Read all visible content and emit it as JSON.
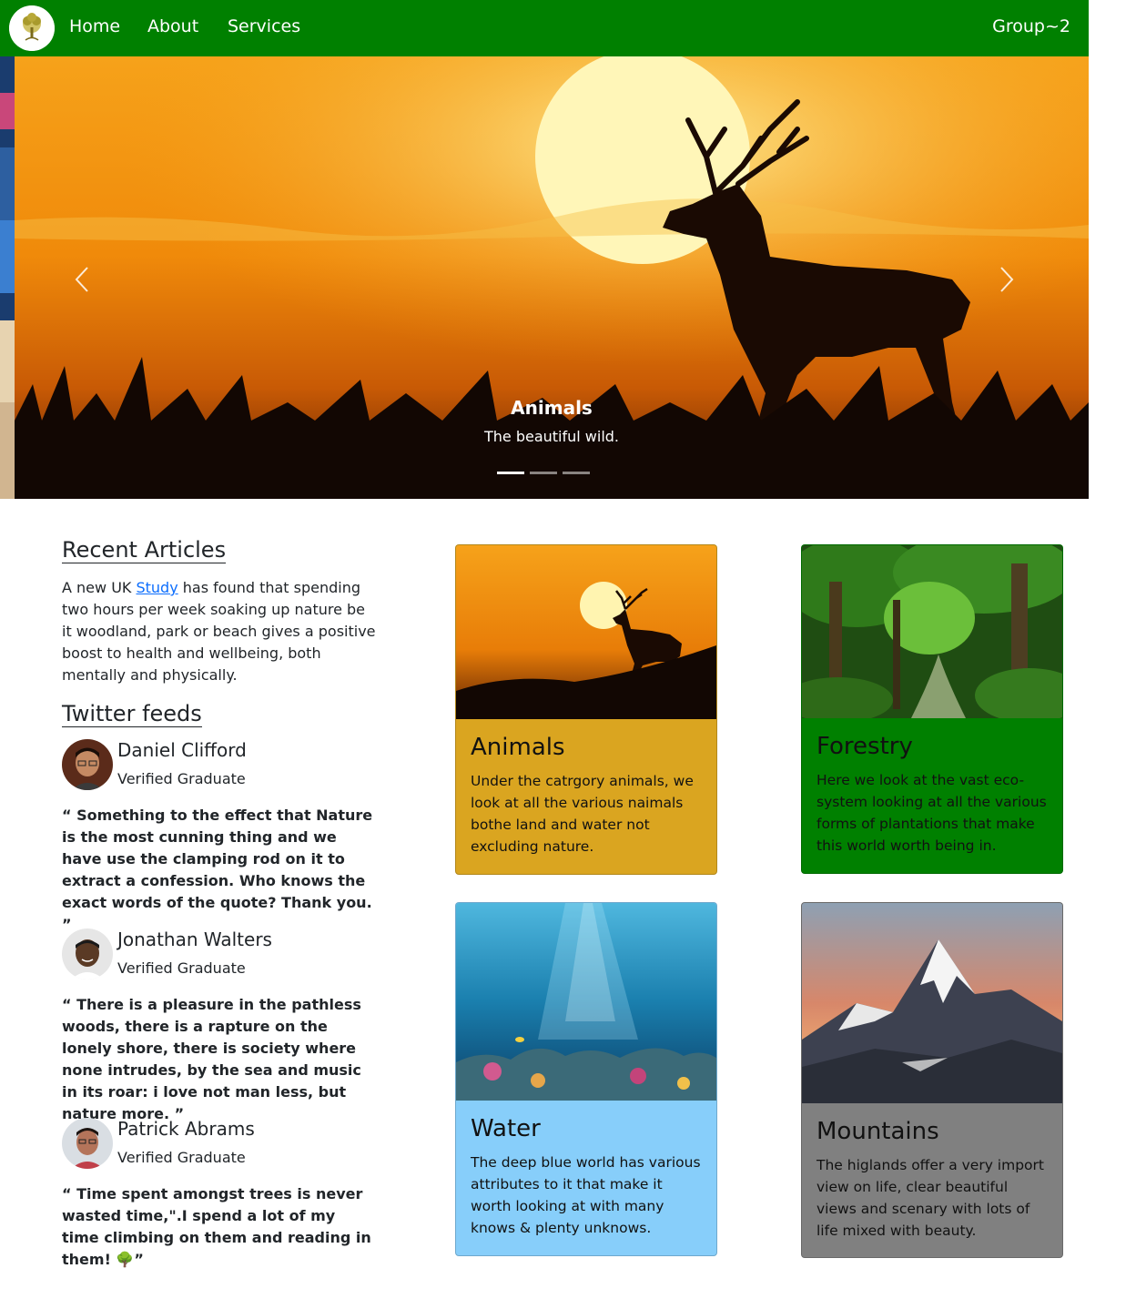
{
  "nav": {
    "logo": "tree-logo",
    "links": [
      "Home",
      "About",
      "Services"
    ],
    "brand": "Group~2",
    "color": "#008000"
  },
  "carousel": {
    "caption_title": "Animals",
    "caption_text": "The beautiful wild.",
    "slide_count": 3,
    "active_slide": 1,
    "prev_icon": "chevron-left-icon",
    "next_icon": "chevron-right-icon"
  },
  "articles": {
    "heading": "Recent Articles",
    "text_before": "A new UK ",
    "link_text": "Study",
    "text_after": " has found that spending two hours per week soaking up nature be it woodland, park or beach gives a positive boost to health and wellbeing, both mentally and physically."
  },
  "twitter": {
    "heading": "Twitter feeds",
    "feeds": [
      {
        "name": "Daniel Clifford",
        "role": "Verified Graduate",
        "quote": "“ Something to the effect that Nature is the most cunning thing and we have use the clamping rod on it to extract a confession. Who knows the exact words of the quote? Thank you. ”"
      },
      {
        "name": "Jonathan Walters",
        "role": "Verified Graduate",
        "quote": "“ There is a pleasure in the pathless woods, there is a rapture on the lonely shore, there is society where none intrudes, by the sea and music in its roar: i love not man less, but nature more. ”"
      },
      {
        "name": "Patrick Abrams",
        "role": "Verified Graduate",
        "quote": "“ Time spent amongst trees is never wasted time,\".I spend a lot of my time climbing on them and reading in them! 🌳”"
      }
    ]
  },
  "cards": [
    {
      "title": "Animals",
      "text": "Under the catrgory animals, we look at all the various naimals bothe land and water not excluding nature.",
      "color": "#daa520"
    },
    {
      "title": "Forestry",
      "text": "Here we look at the vast eco-system looking at all the various forms of plantations that make this world worth being in.",
      "color": "#008000"
    },
    {
      "title": "Water",
      "text": "The deep blue world has various attributes to it that make it worth looking at with many knows & plenty unknows.",
      "color": "#87cefa"
    },
    {
      "title": "Mountains",
      "text": "The higlands offer a very import view on life, clear beautiful views and scenary with lots of life mixed with beauty.",
      "color": "#808080"
    }
  ]
}
